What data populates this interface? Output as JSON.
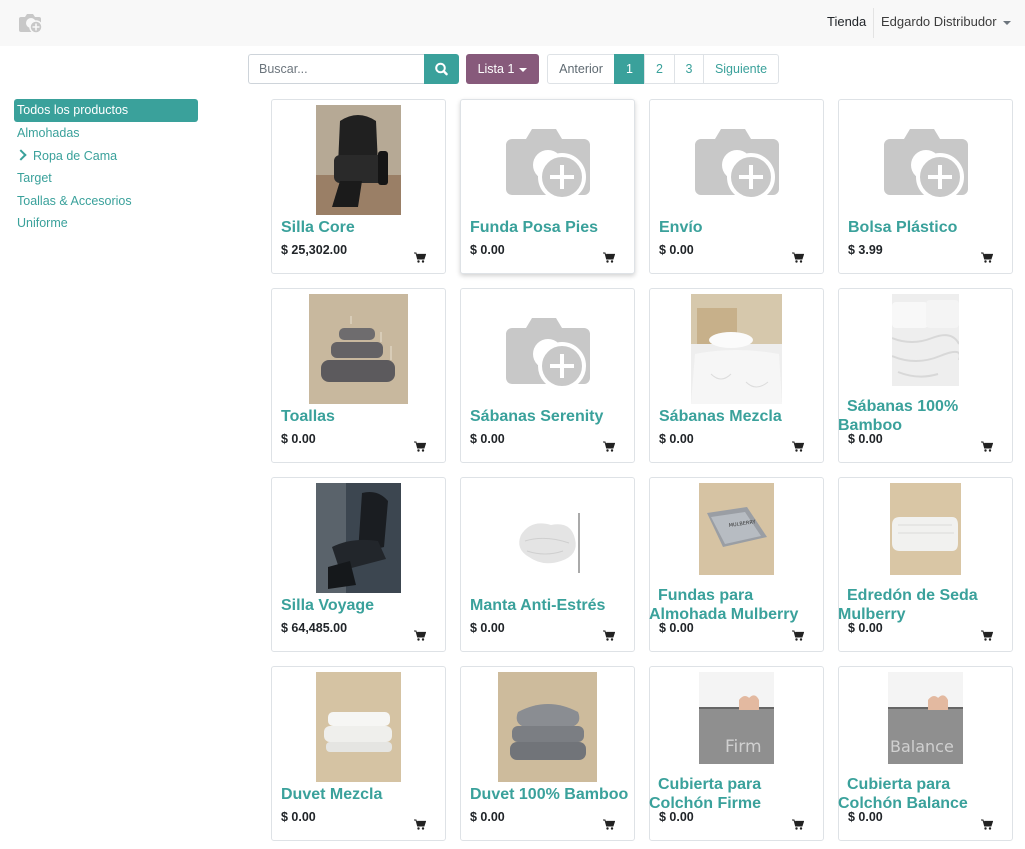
{
  "header": {
    "logo_icon": "camera-plus-icon",
    "nav_shop": "Tienda",
    "user_name": "Edgardo Distribudor"
  },
  "toolbar": {
    "search_placeholder": "Buscar...",
    "search_icon": "search-icon",
    "list_label": "Lista 1",
    "pager": {
      "prev": "Anterior",
      "pages": [
        "1",
        "2",
        "3"
      ],
      "current": "1",
      "next": "Siguiente"
    }
  },
  "sidebar": {
    "items": [
      {
        "label": "Todos los productos",
        "active": true
      },
      {
        "label": "Almohadas"
      },
      {
        "label": "Ropa de Cama",
        "expandable": true
      },
      {
        "label": "Target"
      },
      {
        "label": "Toallas & Accesorios"
      },
      {
        "label": "Uniforme"
      }
    ]
  },
  "products": [
    {
      "name": "Silla Core",
      "price": "$ 25,302.00",
      "image": "black-massage-chair"
    },
    {
      "name": "Funda Posa Pies",
      "price": "$ 0.00",
      "image": "placeholder"
    },
    {
      "name": "Envío",
      "price": "$ 0.00",
      "image": "placeholder"
    },
    {
      "name": "Bolsa Plástico",
      "price": "$ 3.99",
      "image": "placeholder"
    },
    {
      "name": "Toallas",
      "price": "$ 0.00",
      "image": "grey-towel-stack"
    },
    {
      "name": "Sábanas Serenity",
      "price": "$ 0.00",
      "image": "placeholder"
    },
    {
      "name": "Sábanas Mezcla",
      "price": "$ 0.00",
      "image": "white-bed-sheets"
    },
    {
      "name": "Sábanas 100% Bamboo",
      "price": "$ 0.00",
      "image": "white-sheets-closeup"
    },
    {
      "name": "Silla Voyage",
      "price": "$ 64,485.00",
      "image": "dark-massage-chair"
    },
    {
      "name": "Manta Anti-Estrés",
      "price": "$ 0.00",
      "image": "white-blanket"
    },
    {
      "name": "Fundas para Almohada Mulberry",
      "price": "$ 0.00",
      "image": "silk-pillowcase-package"
    },
    {
      "name": "Edredón de Seda Mulberry",
      "price": "$ 0.00",
      "image": "folded-white-comforter"
    },
    {
      "name": "Duvet Mezcla",
      "price": "$ 0.00",
      "image": "folded-white-duvet"
    },
    {
      "name": "Duvet 100% Bamboo",
      "price": "$ 0.00",
      "image": "grey-duvet-with-pillow"
    },
    {
      "name": "Cubierta para Colchón Firme",
      "price": "$ 0.00",
      "image": "mattress-topper-firme",
      "image_text": "Firm"
    },
    {
      "name": "Cubierta para Colchón Balance",
      "price": "$ 0.00",
      "image": "mattress-topper-balance",
      "image_text": "Balance"
    }
  ],
  "cart_icon": "cart-icon",
  "colors": {
    "accent": "#3aa19b",
    "list_button": "#875a7b",
    "placeholder_grey": "#c8c8c8"
  }
}
